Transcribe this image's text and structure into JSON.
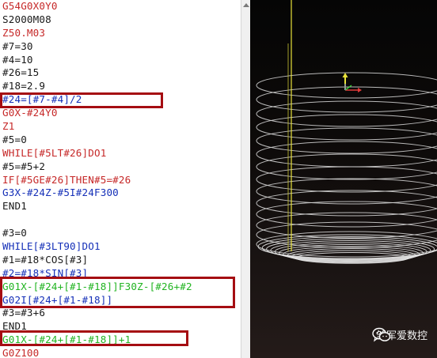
{
  "editor": {
    "lines": [
      {
        "text": "G54G0X0Y0",
        "color": "red"
      },
      {
        "text": "S2000M08",
        "color": "black"
      },
      {
        "text": "Z50.M03",
        "color": "red"
      },
      {
        "text": "#7=30",
        "color": "black"
      },
      {
        "text": "#4=10",
        "color": "black"
      },
      {
        "text": "#26=15",
        "color": "black"
      },
      {
        "text": "#18=2.9",
        "color": "black"
      },
      {
        "text": "#24=[#7-#4]/2",
        "color": "blue"
      },
      {
        "text": "G0X-#24Y0",
        "color": "red"
      },
      {
        "text": "Z1",
        "color": "red"
      },
      {
        "text": "#5=0",
        "color": "black"
      },
      {
        "text": "WHILE[#5LT#26]DO1",
        "color": "red"
      },
      {
        "text": "#5=#5+2",
        "color": "black"
      },
      {
        "text": "IF[#5GE#26]THEN#5=#26",
        "color": "red"
      },
      {
        "text": "G3X-#24Z-#5I#24F300",
        "color": "blue"
      },
      {
        "text": "END1",
        "color": "black"
      },
      {
        "text": "",
        "color": "black"
      },
      {
        "text": "#3=0",
        "color": "black"
      },
      {
        "text": "WHILE[#3LT90]DO1",
        "color": "blue"
      },
      {
        "text": "#1=#18*COS[#3]",
        "color": "black"
      },
      {
        "text": "#2=#18*SIN[#3]",
        "color": "blue"
      },
      {
        "text": "G01X-[#24+[#1-#18]]F30Z-[#26+#2",
        "color": "green"
      },
      {
        "text": "G02I[#24+[#1-#18]]",
        "color": "blue"
      },
      {
        "text": "#3=#3+6",
        "color": "black"
      },
      {
        "text": "END1",
        "color": "black"
      },
      {
        "text": "G01X-[#24+[#1-#18]]+1",
        "color": "green"
      },
      {
        "text": "G0Z100",
        "color": "red"
      }
    ]
  },
  "colors": {
    "red": "#c62828",
    "black": "#1a1a1a",
    "blue": "#1530b8",
    "green": "#22b422",
    "highlight_box": "#a50d12",
    "toolpath": "#d8d8d8",
    "feed_line": "#e8e23a"
  },
  "viewport": {
    "axis_icon": "xyz-axis-icon",
    "toolpath": "helical-toolpath-spiral"
  },
  "watermark": {
    "icon": "wechat-logo-icon",
    "text": "邹军爱数控"
  }
}
